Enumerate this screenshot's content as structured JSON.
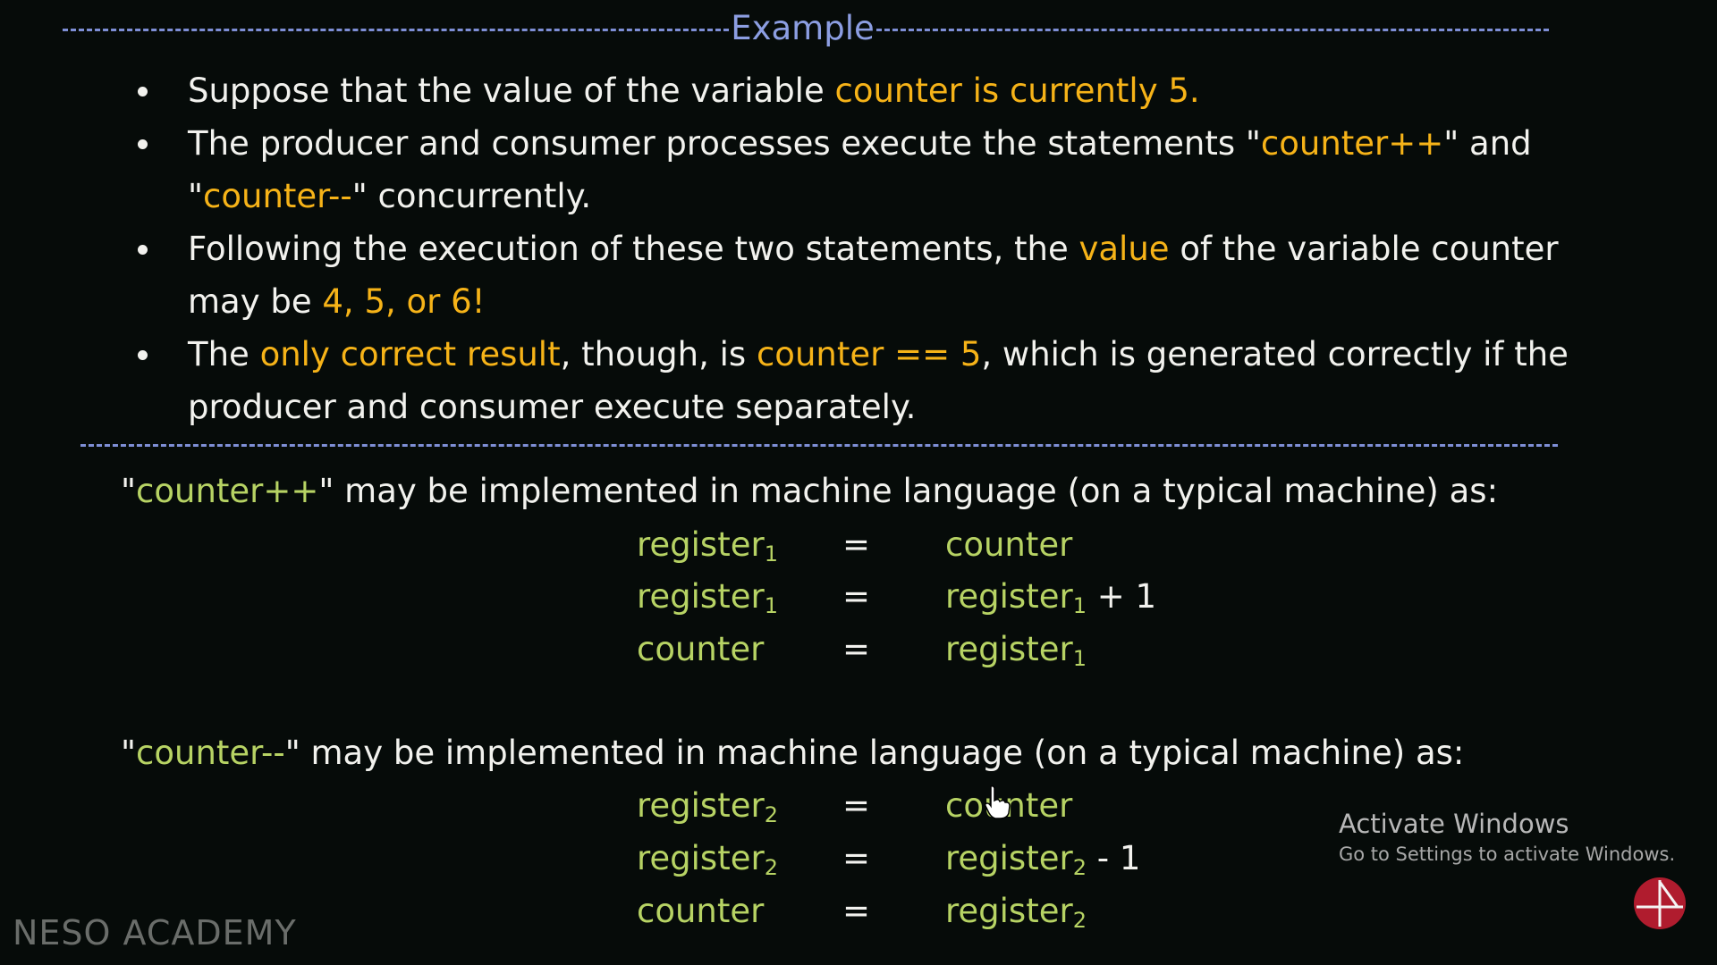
{
  "header": {
    "title": "Example"
  },
  "bullets": [
    {
      "t1": "Suppose that the value of the variable ",
      "h1": "counter is currently 5."
    },
    {
      "t1": "The producer and consumer processes execute the statements \"",
      "h1": "counter++",
      "t2": "\" and \"",
      "h2": "counter--",
      "t3": "\" concurrently."
    },
    {
      "t1": "Following the execution of these two statements, the ",
      "h1": "value",
      "t2": " of the variable counter may be ",
      "h2": "4, 5, or 6!"
    },
    {
      "t1": "The ",
      "h1": "only correct result",
      "t2": ", though, is ",
      "h2": "counter == 5",
      "t3": ", which is generated correctly if the producer and consumer execute separately."
    }
  ],
  "increment": {
    "open_quote": "\"",
    "op": "counter++",
    "close_rest": "\" may be implemented in machine language (on a typical machine) as:",
    "rows": [
      {
        "left": "register",
        "left_sub": "1",
        "eq": "=",
        "right": "counter",
        "right_sub": "",
        "right_tail": ""
      },
      {
        "left": "register",
        "left_sub": "1",
        "eq": "=",
        "right": "register",
        "right_sub": "1",
        "right_tail": " + 1"
      },
      {
        "left": "counter",
        "left_sub": "",
        "eq": "=",
        "right": "register",
        "right_sub": "1",
        "right_tail": ""
      }
    ]
  },
  "decrement": {
    "open_quote": "\"",
    "op": "counter--",
    "close_rest": "\" may be implemented in machine language (on a typical machine) as:",
    "rows": [
      {
        "left": "register",
        "left_sub": "2",
        "eq": "=",
        "right": "counter",
        "right_sub": "",
        "right_tail": ""
      },
      {
        "left": "register",
        "left_sub": "2",
        "eq": "=",
        "right": "register",
        "right_sub": "2",
        "right_tail": " - 1"
      },
      {
        "left": "counter",
        "left_sub": "",
        "eq": "=",
        "right": "register",
        "right_sub": "2",
        "right_tail": ""
      }
    ]
  },
  "branding": {
    "name": "NESO ACADEMY"
  },
  "watermark": {
    "title": "Activate Windows",
    "subtitle": "Go to Settings to activate Windows."
  },
  "colors": {
    "highlight": "#f6b318",
    "code_green": "#b7d364",
    "dash_blue": "#7e8fd6",
    "background": "#060b09"
  },
  "icons": [
    "neso-logo-icon",
    "hand-cursor-icon"
  ]
}
